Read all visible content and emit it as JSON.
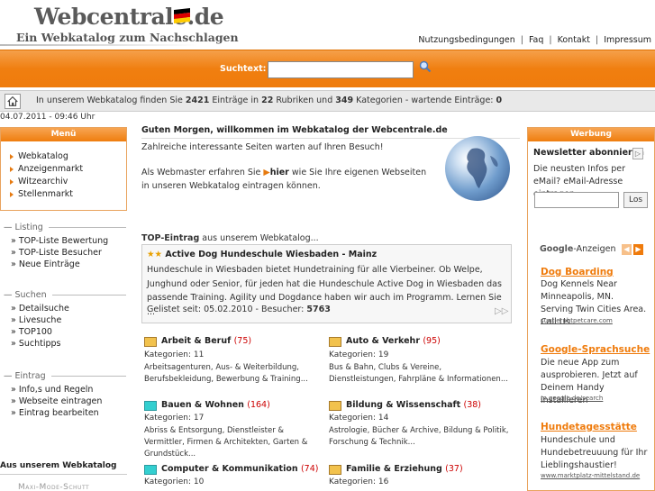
{
  "header": {
    "logo_title": "Webcentrale.de",
    "logo_subtitle": "Ein Webkatalog zum Nachschlagen",
    "links": [
      "Nutzungsbedingungen",
      "Faq",
      "Kontakt",
      "Impressum"
    ],
    "separator": "|"
  },
  "search": {
    "label": "Suchtext:",
    "value": ""
  },
  "info": {
    "prefix": "In unserem Webkatalog finden Sie",
    "entries": "2421",
    "mid1": "Einträge in",
    "rubrics": "22",
    "mid2": "Rubriken und",
    "categories": "349",
    "suffix": "Kategorien - wartende Einträge:",
    "waiting": "0"
  },
  "datetime": "04.07.2011 - 09:46 Uhr",
  "menu": {
    "title": "Menü",
    "items": [
      "Webkatalog",
      "Anzeigenmarkt",
      "Witzearchiv",
      "Stellenmarkt"
    ]
  },
  "listing": {
    "title": "Listing",
    "items": [
      "» TOP-Liste Bewertung",
      "» TOP-Liste Besucher",
      "» Neue Einträge"
    ]
  },
  "suchen": {
    "title": "Suchen",
    "items": [
      "» Detailsuche",
      "» Livesuche",
      "» TOP100",
      "» Suchtipps"
    ]
  },
  "eintrag": {
    "title": "Eintrag",
    "items": [
      "» Info,s und Regeln",
      "» Webseite eintragen",
      "» Eintrag bearbeiten"
    ]
  },
  "aus": {
    "title": "Aus unserem Webkatalog",
    "item": "Maxi-Mode-Schutt"
  },
  "main": {
    "greeting": "Guten Morgen, willkommen im Webkatalog der Webcentrale.de",
    "welcome": "Zahlreiche interessante Seiten warten auf Ihren Besuch!",
    "webmaster_a": "Als Webmaster erfahren Sie",
    "webmaster_link": "hier",
    "webmaster_b": "wie Sie Ihre eigenen Webseiten in unseren Webkatalog eintragen können."
  },
  "top_entry": {
    "label_bold": "TOP-Eintrag",
    "label_rest": "aus unserem Webkatalog...",
    "stars": "★★",
    "name": "Active Dog Hundeschule Wiesbaden - Mainz",
    "description": "Hundeschule in Wiesbaden bietet Hundetraining für alle Vierbeiner. Ob Welpe, Junghund oder Senior, für jeden hat die Hundeschule Active Dog in Wiesbaden das passende Training. Agility und Dogdance haben wir auch im Programm. Lernen Sie ...",
    "listed_label": "Gelistet seit: 05.02.2010 - Besucher:",
    "visitors": "5763",
    "next": "▷▷"
  },
  "categories": [
    {
      "title": "Arbeit & Beruf",
      "count": "(75)",
      "sub": "Kategorien: 11",
      "links": "Arbeitsagenturen, Aus- & Weiterbildung, Berufsbekleidung, Bewerbung & Training..."
    },
    {
      "title": "Auto & Verkehr",
      "count": "(95)",
      "sub": "Kategorien: 19",
      "links": "Bus & Bahn, Clubs & Vereine, Dienstleistungen, Fahrpläne & Informationen..."
    },
    {
      "title": "Bauen & Wohnen",
      "count": "(164)",
      "sub": "Kategorien: 17",
      "links": "Abriss & Entsorgung, Dienstleister & Vermittler, Firmen & Architekten, Garten & Grundstück..."
    },
    {
      "title": "Bildung & Wissenschaft",
      "count": "(38)",
      "sub": "Kategorien: 14",
      "links": "Astrologie, Bücher & Archive, Bildung & Politik, Forschung & Technik..."
    },
    {
      "title": "Computer & Kommunikation",
      "count": "(74)",
      "sub": "Kategorien: 10",
      "links": ""
    },
    {
      "title": "Familie & Erziehung",
      "count": "(37)",
      "sub": "Kategorien: 16",
      "links": ""
    }
  ],
  "werbung": {
    "title": "Werbung",
    "news_title": "Newsletter abonnieren",
    "news_btn": "▷",
    "news_text": "Die neusten Infos per eMail? eMail-Adresse eintragen...",
    "news_submit": "Los",
    "ads_brand": "Google",
    "ads_label": "-Anzeigen",
    "prev": "◀",
    "next": "▶",
    "ads": [
      {
        "title": "Dog Boarding",
        "text": "Dog Kennels Near Minneapolis, MN. Serving Twin Cities Area. Call Us.",
        "url": "suntieruhtpetcare.com"
      },
      {
        "title": "Google-Sprachsuche",
        "text": "Die neue App zum ausprobieren. Jetzt auf Deinem Handy installieren",
        "url": "m.google.de/search"
      },
      {
        "title": "Hundetagesstätte",
        "text": "Hundeschule und Hundebetreuuung für Ihr Lieblingshaustier!",
        "url": "www.marktplatz-mittelstand.de"
      }
    ]
  },
  "colors": {
    "accent": "#ef7b0c",
    "count": "#cc0000"
  }
}
